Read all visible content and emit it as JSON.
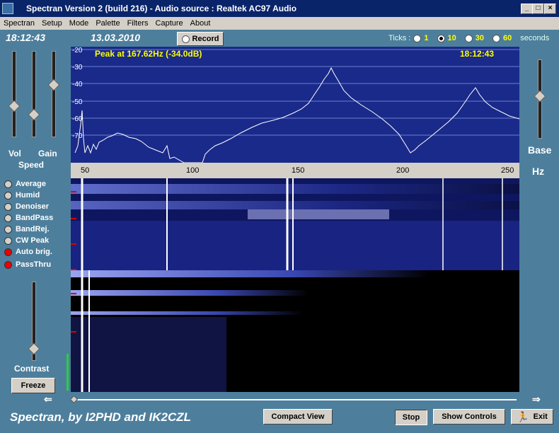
{
  "window": {
    "title": "Spectran Version 2 (build 216) - Audio source  :  Realtek AC97 Audio"
  },
  "menu": [
    "Spectran",
    "Setup",
    "Mode",
    "Palette",
    "Filters",
    "Capture",
    "About"
  ],
  "toolbar": {
    "time": "18:12:43",
    "date": "13.03.2010",
    "record_label": "Record"
  },
  "ticks": {
    "label": "Ticks :",
    "options": [
      "1",
      "10",
      "30",
      "60"
    ],
    "selected": "10",
    "unit": "seconds"
  },
  "spectrum": {
    "peak_text": "Peak at   167.62Hz (-34.0dB)",
    "clock": "18:12:43",
    "db_labels": [
      "-20",
      "-30",
      "-40",
      "-50",
      "-60",
      "-70"
    ],
    "freq_labels": [
      "50",
      "100",
      "150",
      "200",
      "250"
    ]
  },
  "left_panel": {
    "vol_label": "Vol",
    "gain_label": "Gain",
    "speed_label": "Speed",
    "options": [
      {
        "label": "Average",
        "active": false
      },
      {
        "label": "Humid",
        "active": false
      },
      {
        "label": "Denoiser",
        "active": false
      },
      {
        "label": "BandPass",
        "active": false
      },
      {
        "label": "BandRej.",
        "active": false
      },
      {
        "label": "CW Peak",
        "active": false
      },
      {
        "label": "Auto brig.",
        "active": true
      },
      {
        "label": "PassThru",
        "active": true
      }
    ],
    "contrast_label": "Contrast",
    "freeze_label": "Freeze"
  },
  "right_panel": {
    "base_label": "Base",
    "hz_label": "Hz"
  },
  "footer": {
    "title": "Spectran, by I2PHD and IK2CZL",
    "compact_label": "Compact View",
    "stop_label": "Stop",
    "show_controls_label": "Show Controls",
    "exit_label": "Exit"
  }
}
